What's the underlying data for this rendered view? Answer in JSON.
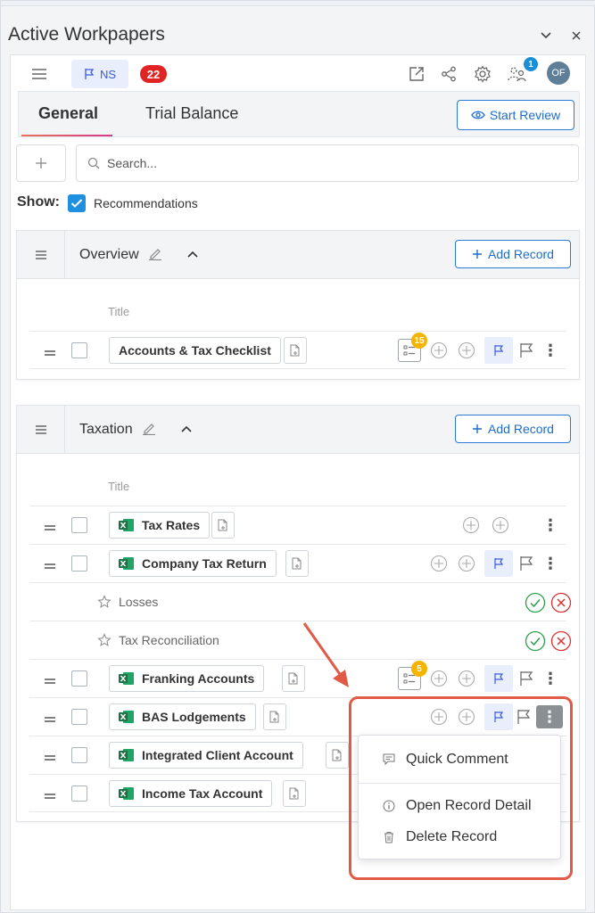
{
  "window": {
    "title": "Active Workpapers",
    "collapse_icon": "chevron-down-icon",
    "close_icon": "close-icon"
  },
  "toolbar": {
    "ns_label": "NS",
    "count_badge": "22",
    "notification_count": "1",
    "avatar_initials": "OF"
  },
  "tabs": {
    "items": [
      {
        "label": "General",
        "active": true
      },
      {
        "label": "Trial Balance",
        "active": false
      }
    ],
    "start_review_label": "Start Review"
  },
  "search": {
    "placeholder": "Search..."
  },
  "filter": {
    "show_label": "Show:",
    "recommendations_label": "Recommendations",
    "recommendations_checked": true
  },
  "sections": [
    {
      "title": "Overview",
      "add_record_label": "Add Record",
      "column_title": "Title",
      "rows": [
        {
          "label": "Accounts & Tax Checklist",
          "excel": false,
          "checklist_badge": "15",
          "flagged": true
        }
      ]
    },
    {
      "title": "Taxation",
      "add_record_label": "Add Record",
      "column_title": "Title",
      "rows": [
        {
          "label": "Tax Rates",
          "excel": true,
          "flagged": false
        },
        {
          "label": "Company Tax Return",
          "excel": true,
          "flagged": true
        },
        {
          "label": "Losses",
          "sub": true
        },
        {
          "label": "Tax Reconciliation",
          "sub": true
        },
        {
          "label": "Franking Accounts",
          "excel": true,
          "checklist_badge": "5",
          "flagged": true
        },
        {
          "label": "BAS Lodgements",
          "excel": true,
          "flagged": true,
          "menu_open": true
        },
        {
          "label": "Integrated Client Account",
          "excel": true
        },
        {
          "label": "Income Tax Account",
          "excel": true
        }
      ]
    }
  ],
  "context_menu": {
    "items": [
      {
        "label": "Quick Comment",
        "icon": "comment-icon"
      },
      {
        "label": "Open Record Detail",
        "icon": "info-icon"
      },
      {
        "label": "Delete Record",
        "icon": "trash-icon"
      }
    ]
  },
  "colors": {
    "accent_blue": "#1c6cc9",
    "badge_red": "#e02424",
    "checklist_yellow": "#f5b400",
    "excel_green": "#1e7145",
    "annotation_red": "#e05a45"
  }
}
